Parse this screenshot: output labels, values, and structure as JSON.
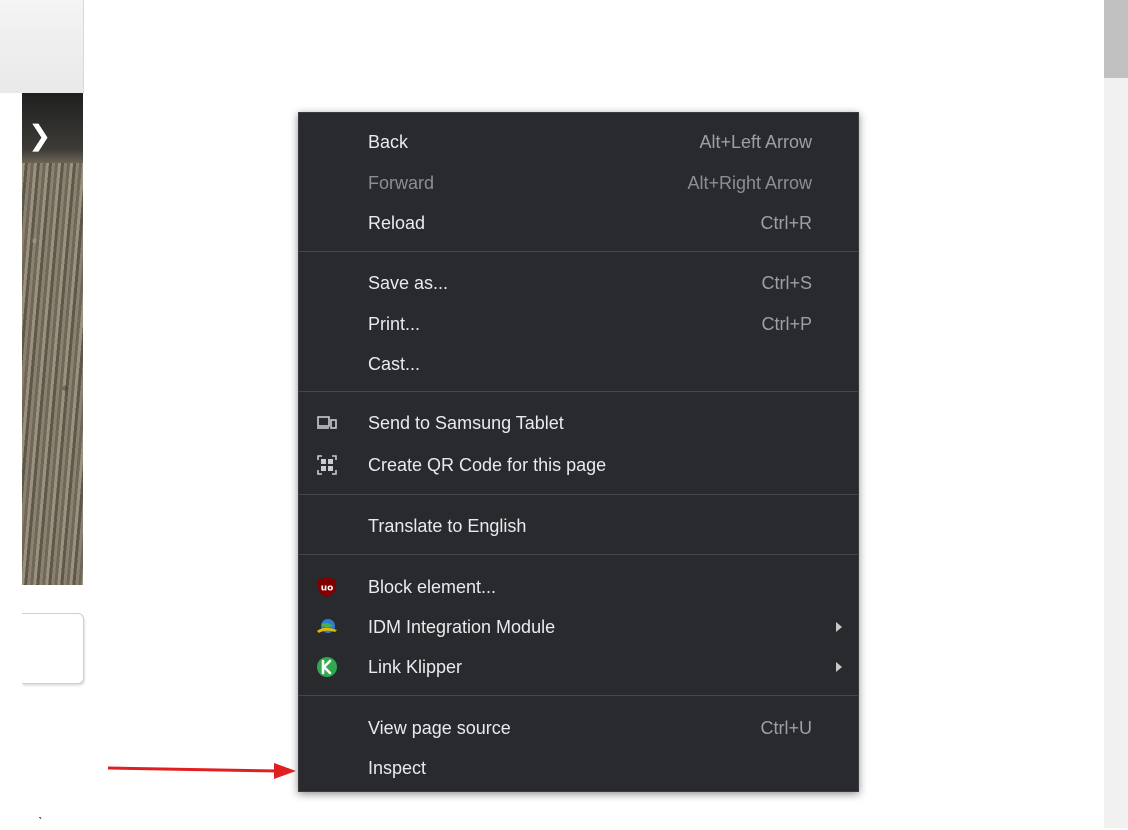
{
  "menu": {
    "items": [
      {
        "label": "Back",
        "shortcut": "Alt+Left Arrow"
      },
      {
        "label": "Forward",
        "shortcut": "Alt+Right Arrow"
      },
      {
        "label": "Reload",
        "shortcut": "Ctrl+R"
      },
      {
        "label": "Save as...",
        "shortcut": "Ctrl+S"
      },
      {
        "label": "Print...",
        "shortcut": "Ctrl+P"
      },
      {
        "label": "Cast..."
      },
      {
        "label": "Send to Samsung Tablet",
        "icon": "devices-icon"
      },
      {
        "label": "Create QR Code for this page",
        "icon": "qr-code-icon"
      },
      {
        "label": "Translate to English"
      },
      {
        "label": "Block element...",
        "icon": "ublock-shield-icon"
      },
      {
        "label": "IDM Integration Module",
        "icon": "idm-globe-icon"
      },
      {
        "label": "Link Klipper",
        "icon": "link-klipper-icon"
      },
      {
        "label": "View page source",
        "shortcut": "Ctrl+U"
      },
      {
        "label": "Inspect"
      }
    ]
  },
  "colors": {
    "menu_bg": "#292a2d",
    "menu_text": "#e8eaed",
    "disabled_text": "#8b8f94",
    "annotation_arrow": "#e02020"
  }
}
